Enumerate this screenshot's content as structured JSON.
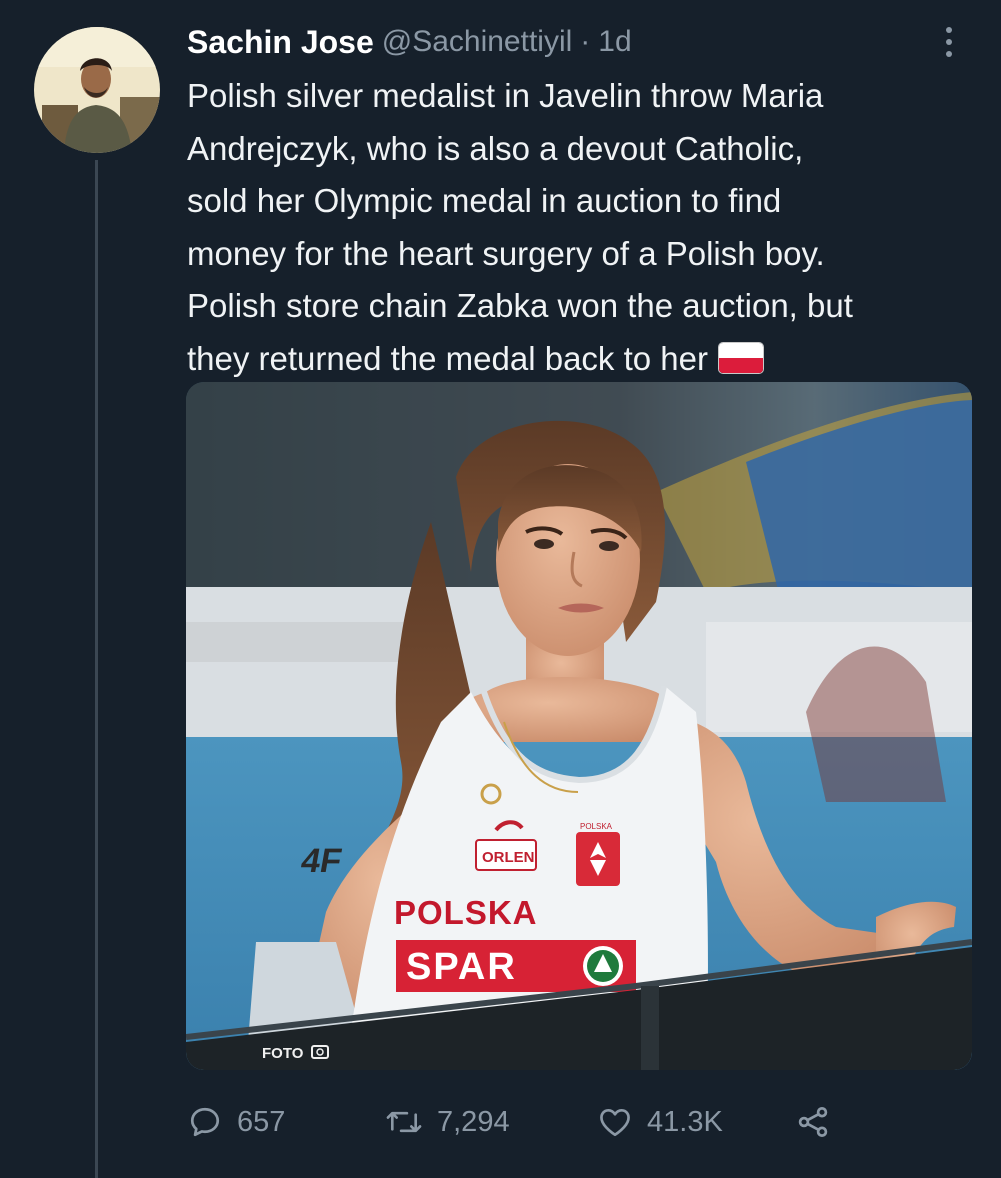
{
  "tweet": {
    "author": {
      "display_name": "Sachin Jose",
      "handle": "@Sachinettiyil",
      "separator": "·",
      "timestamp": "1d"
    },
    "text_lines": [
      "Polish silver medalist in Javelin throw Maria",
      "Andrejczyk, who is also a devout Catholic,",
      "sold her Olympic  medal in auction to find",
      "money for the heart surgery of a Polish boy.",
      "Polish store chain Zabka won the auction, but",
      "they returned the medal back to her"
    ],
    "emoji": "flag-poland",
    "media": {
      "jersey_brand": "4F",
      "jersey_sponsor": "ORLEN",
      "jersey_team": "POLSKA",
      "jersey_crest_label": "POLSKA",
      "bib_sponsor": "SPAR",
      "watermark": "FOTO"
    },
    "actions": {
      "reply_count": "657",
      "retweet_count": "7,294",
      "like_count": "41.3K"
    }
  },
  "colors": {
    "background": "#16202b",
    "text": "#f0f3f5",
    "secondary_text": "#8b98a5",
    "thread_line": "#3b4753",
    "flag_red": "#dc1c3b"
  },
  "icons": {
    "reply": "reply-icon",
    "retweet": "retweet-icon",
    "like": "heart-icon",
    "share": "share-icon",
    "more": "more-icon"
  }
}
